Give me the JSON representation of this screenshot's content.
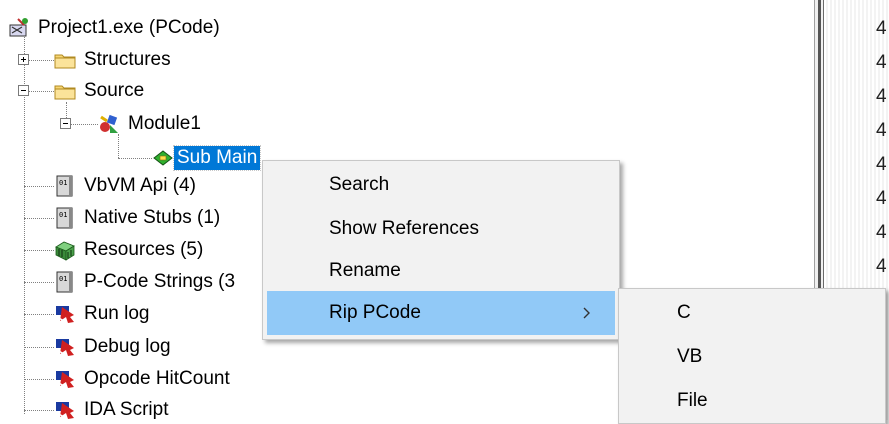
{
  "tree": {
    "root": {
      "label": "Project1.exe  (PCode)",
      "icon": "project-icon"
    },
    "structures": {
      "label": "Structures",
      "icon": "folder-icon"
    },
    "source": {
      "label": "Source",
      "icon": "folder-icon"
    },
    "module1": {
      "label": "Module1",
      "icon": "module-icon"
    },
    "submain": {
      "label": "Sub Main",
      "icon": "sub-icon",
      "selected": true
    },
    "vbvm": {
      "label": "VbVM Api (4)",
      "icon": "binary-file-icon"
    },
    "native": {
      "label": "Native Stubs (1)",
      "icon": "binary-file-icon"
    },
    "resources": {
      "label": "Resources (5)",
      "icon": "resources-icon"
    },
    "pcode": {
      "label": "P-Code Strings (3",
      "icon": "binary-file-icon"
    },
    "runlog": {
      "label": "Run log",
      "icon": "log-icon"
    },
    "debuglog": {
      "label": "Debug log",
      "icon": "log-icon"
    },
    "opcode": {
      "label": "Opcode HitCount",
      "icon": "log-icon"
    },
    "ida": {
      "label": "IDA Script",
      "icon": "log-icon"
    }
  },
  "context_menu": {
    "search": "Search",
    "show_references": "Show References",
    "rename": "Rename",
    "rip_pcode": "Rip PCode"
  },
  "submenu": {
    "c": "C",
    "vb": "VB",
    "file": "File"
  },
  "right_pane": {
    "digit": "4"
  },
  "colors": {
    "selection": "#0078d7",
    "menu_highlight": "#91c9f7",
    "menu_bg": "#f2f2f2"
  }
}
